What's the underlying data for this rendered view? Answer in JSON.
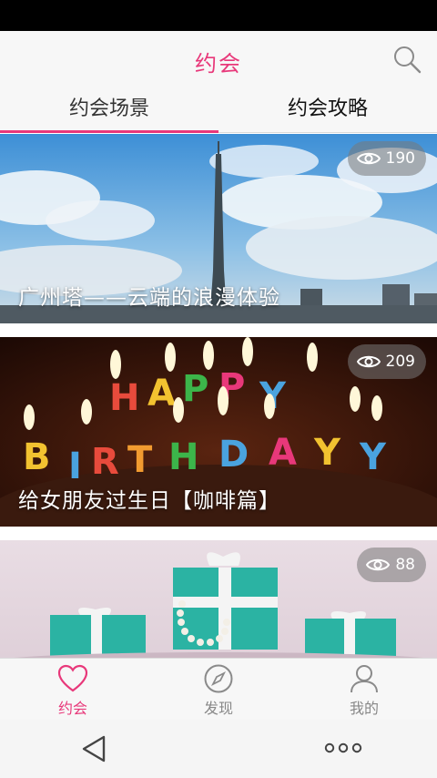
{
  "header": {
    "title": "约会",
    "search_icon": "search-icon"
  },
  "tabs": [
    {
      "label": "约会场景",
      "selected": true
    },
    {
      "label": "约会攻略",
      "selected": false
    }
  ],
  "colors": {
    "accent": "#e8387a",
    "inactive": "#888888"
  },
  "feed": {
    "cards": [
      {
        "title": "广州塔——云端的浪漫体验",
        "views": "190"
      },
      {
        "title": "给女朋友过生日【咖啡篇】",
        "views": "209"
      },
      {
        "title": "",
        "views": "88"
      }
    ]
  },
  "bottom_nav": {
    "items": [
      {
        "label": "约会",
        "icon": "heart-icon",
        "active": true
      },
      {
        "label": "发现",
        "icon": "compass-icon",
        "active": false
      },
      {
        "label": "我的",
        "icon": "user-icon",
        "active": false
      }
    ]
  },
  "system_nav": {
    "back_icon": "back-triangle-icon",
    "more_icon": "more-dots-icon"
  }
}
